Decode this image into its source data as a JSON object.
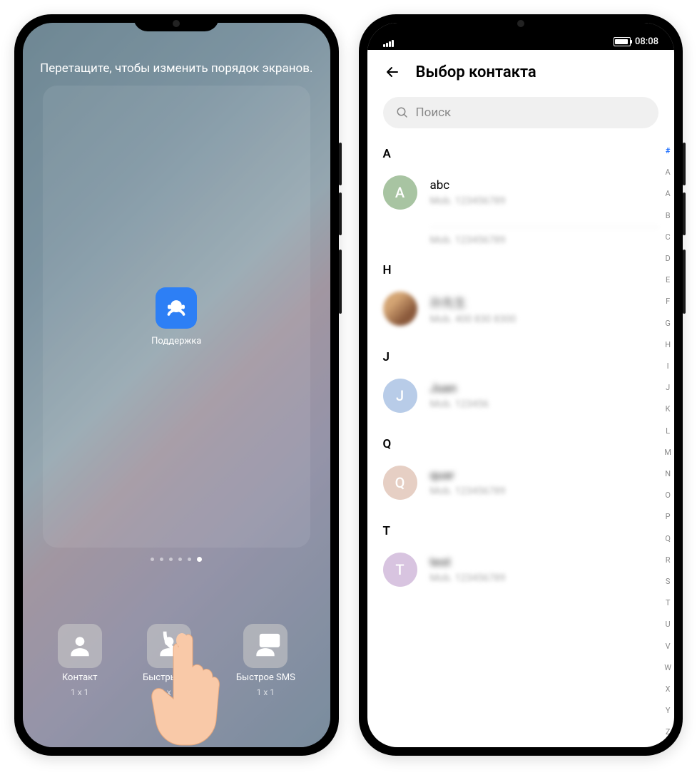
{
  "left": {
    "hint": "Перетащите, чтобы изменить порядок экранов.",
    "app": {
      "label": "Поддержка"
    },
    "page_dots": 6,
    "active_dot": 5,
    "widgets": [
      {
        "label": "Контакт",
        "size": "1 x 1",
        "corner": null
      },
      {
        "label": "Быстрый зв",
        "size": "1 x 1",
        "corner": "phone"
      },
      {
        "label": "Быстрое SMS",
        "size": "1 x 1",
        "corner": "sms"
      }
    ]
  },
  "right": {
    "status": {
      "time": "08:08"
    },
    "header": {
      "title": "Выбор контакта"
    },
    "search": {
      "placeholder": "Поиск"
    },
    "sections": [
      {
        "letter": "A",
        "contacts": [
          {
            "avatar_letter": "A",
            "avatar_color": "#a8c4a2",
            "name": "abc",
            "sub": "Mob. 123456789",
            "extra_sub": "Mob. 123456789",
            "blurred": false
          }
        ]
      },
      {
        "letter": "H",
        "contacts": [
          {
            "avatar_photo": true,
            "name": "孙先生",
            "sub": "Mob. 400 830 8300",
            "blurred": true
          }
        ]
      },
      {
        "letter": "J",
        "contacts": [
          {
            "avatar_letter": "J",
            "avatar_color": "#b8cce8",
            "name": "Juan",
            "sub": "Mob. 123456",
            "blurred": true
          }
        ]
      },
      {
        "letter": "Q",
        "contacts": [
          {
            "avatar_letter": "Q",
            "avatar_color": "#e6cfc4",
            "name": "quar",
            "sub": "Mob. 123456789",
            "blurred": true
          }
        ]
      },
      {
        "letter": "T",
        "contacts": [
          {
            "avatar_letter": "T",
            "avatar_color": "#d8c4e0",
            "name": "test",
            "sub": "Mob. 123456789",
            "blurred": true
          }
        ]
      }
    ],
    "index": [
      "#",
      "A",
      "A",
      "B",
      "C",
      "D",
      "E",
      "F",
      "G",
      "H",
      "I",
      "J",
      "K",
      "L",
      "M",
      "N",
      "O",
      "P",
      "Q",
      "R",
      "S",
      "T",
      "U",
      "V",
      "W",
      "X",
      "Y",
      "Z"
    ],
    "index_active": "#"
  }
}
